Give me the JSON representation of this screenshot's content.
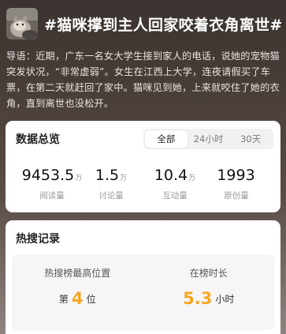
{
  "topic": {
    "title": "#猫咪撑到主人回家咬着衣角离世#",
    "guide_label": "导语：",
    "guide_text": "近期，广东一名女大学生接到家人的电话，说她的宠物猫突发状况，“非常虚弱”。女生在江西上大学，连夜请假买了车票，在第二天就赶回了家中。猫咪见到她，上来就咬住了她的衣角，直到离世也没松开。"
  },
  "overview": {
    "title": "数据总览",
    "tabs": [
      "全部",
      "24小时",
      "30天"
    ],
    "active_tab": "全部",
    "stats": [
      {
        "value": "9453.5",
        "unit": "万",
        "label": "阅读量"
      },
      {
        "value": "1.5",
        "unit": "万",
        "label": "讨论量"
      },
      {
        "value": "10.4",
        "unit": "万",
        "label": "互动量"
      },
      {
        "value": "1993",
        "unit": "",
        "label": "原创量"
      }
    ]
  },
  "hot_record": {
    "title": "热搜记录",
    "peak": {
      "label": "热搜榜最高位置",
      "prefix": "第",
      "value": "4",
      "suffix": "位"
    },
    "duration": {
      "label": "在榜时长",
      "value": "5.3",
      "suffix": "小时"
    }
  },
  "colors": {
    "accent": "#f5a623",
    "background": "#3f3733"
  }
}
